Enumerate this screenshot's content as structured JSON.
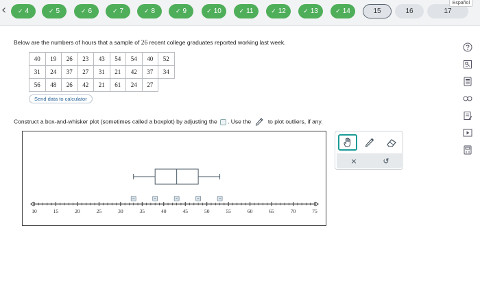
{
  "nav": {
    "questions": [
      {
        "label": "4",
        "state": "done"
      },
      {
        "label": "5",
        "state": "done"
      },
      {
        "label": "6",
        "state": "done"
      },
      {
        "label": "7",
        "state": "done"
      },
      {
        "label": "8",
        "state": "done"
      },
      {
        "label": "9",
        "state": "done"
      },
      {
        "label": "10",
        "state": "done"
      },
      {
        "label": "11",
        "state": "done"
      },
      {
        "label": "12",
        "state": "done"
      },
      {
        "label": "13",
        "state": "done"
      },
      {
        "label": "14",
        "state": "done"
      },
      {
        "label": "15",
        "state": "current"
      },
      {
        "label": "16",
        "state": "todo"
      },
      {
        "label": "17",
        "state": "todo"
      }
    ],
    "language": "Español",
    "check_icon": "check-icon",
    "back_icon": "chevron-left-icon"
  },
  "problem": {
    "intro_before": "Below are the numbers of hours that a sample of ",
    "sample_size": "26",
    "intro_after": " recent college graduates reported working last week.",
    "table": [
      [
        "40",
        "19",
        "26",
        "23",
        "43",
        "54",
        "54",
        "40",
        "52"
      ],
      [
        "31",
        "24",
        "37",
        "27",
        "31",
        "21",
        "42",
        "37",
        "34"
      ],
      [
        "56",
        "48",
        "26",
        "42",
        "21",
        "61",
        "24",
        "27",
        ""
      ]
    ],
    "calculator_button": "Send data to calculator",
    "instruction_before": "Construct a box-and-whisker plot (sometimes called a boxplot) by adjusting the ",
    "instruction_middle": ". Use the ",
    "instruction_after": " to plot outliers, if any."
  },
  "plot": {
    "axis_min": 10,
    "axis_max": 75,
    "axis_labels": [
      "10",
      "15",
      "20",
      "25",
      "30",
      "35",
      "40",
      "45",
      "50",
      "55",
      "60",
      "65",
      "70",
      "75"
    ],
    "whisker_low": 33,
    "q1": 38,
    "median": 43,
    "q3": 48,
    "whisker_high": 53
  },
  "toolbox": {
    "tools": [
      {
        "name": "hand-tool",
        "active": true
      },
      {
        "name": "pencil-tool",
        "active": false
      },
      {
        "name": "eraser-tool",
        "active": false
      }
    ],
    "clear_label": "×",
    "undo_label": "↺"
  },
  "colors": {
    "done": "#4fae5a",
    "accent": "#1a9c96",
    "handle_fill": "#dce7ee"
  },
  "side_tools": [
    "help-icon",
    "reference-icon",
    "calculator-icon",
    "glossary-icon",
    "notes-icon",
    "video-icon",
    "formula-icon"
  ]
}
